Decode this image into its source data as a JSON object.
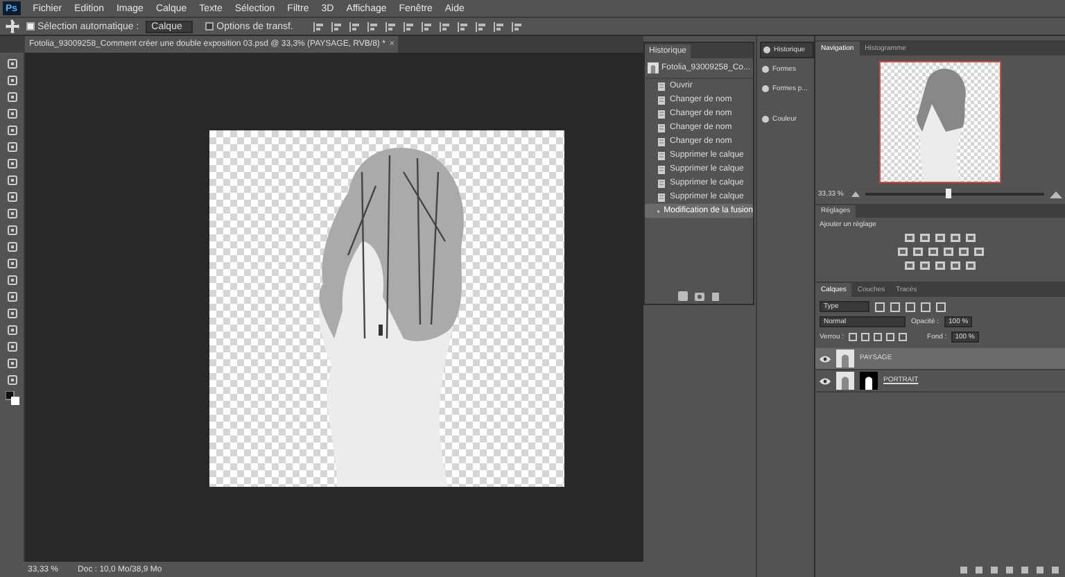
{
  "app_logo": "Ps",
  "menu": [
    "Fichier",
    "Edition",
    "Image",
    "Calque",
    "Texte",
    "Sélection",
    "Filtre",
    "3D",
    "Affichage",
    "Fenêtre",
    "Aide"
  ],
  "options_bar": {
    "auto_select": {
      "label": "Sélection automatique :",
      "checked": true
    },
    "target": "Calque",
    "transform": {
      "label": "Options de transf.",
      "checked": false
    }
  },
  "document_tab": {
    "title": "Fotolia_93009258_Comment créer une double exposition 03.psd @ 33,3% (PAYSAGE, RVB/8) *",
    "close": "×"
  },
  "history": {
    "tab": "Historique",
    "snapshot": "Fotolia_93009258_Co...",
    "items": [
      {
        "label": "Ouvrir",
        "selected": false
      },
      {
        "label": "Changer de nom",
        "selected": false
      },
      {
        "label": "Changer de nom",
        "selected": false
      },
      {
        "label": "Changer de nom",
        "selected": false
      },
      {
        "label": "Changer de nom",
        "selected": false
      },
      {
        "label": "Supprimer le calque",
        "selected": false
      },
      {
        "label": "Supprimer le calque",
        "selected": false
      },
      {
        "label": "Supprimer le calque",
        "selected": false
      },
      {
        "label": "Supprimer le calque",
        "selected": false
      },
      {
        "label": "Modification de la fusion",
        "selected": true
      }
    ]
  },
  "panel_strip": [
    {
      "label": "Historique",
      "selected": true
    },
    {
      "label": "Formes",
      "selected": false
    },
    {
      "label": "Formes p...",
      "selected": false
    },
    {
      "label": "Couleur",
      "selected": false
    }
  ],
  "navigator": {
    "tabs": [
      {
        "label": "Navigation",
        "selected": true
      },
      {
        "label": "Histogramme",
        "selected": false
      }
    ],
    "zoom": "33,33 %",
    "level": 0.45
  },
  "adjustments": {
    "tab": "Réglages",
    "label": "Ajouter un réglage"
  },
  "layers": {
    "tabs": [
      {
        "label": "Calques",
        "selected": true
      },
      {
        "label": "Couches",
        "selected": false
      },
      {
        "label": "Tracés",
        "selected": false
      }
    ],
    "filter": "Type",
    "blend": "Normal",
    "opacity_label": "Opacité :",
    "opacity": "100 %",
    "lock_label": "Verrou :",
    "fill_label": "Fond :",
    "fill": "100 %",
    "items": [
      {
        "name": "PAYSAGE",
        "visible": true,
        "selected": true,
        "kind": "plain"
      },
      {
        "name": "PORTRAIT",
        "visible": true,
        "selected": false,
        "kind": "masked"
      }
    ]
  },
  "status_bar": {
    "zoom": "33,33 %",
    "doc": "Doc : 10,0 Mo/38,9 Mo"
  }
}
